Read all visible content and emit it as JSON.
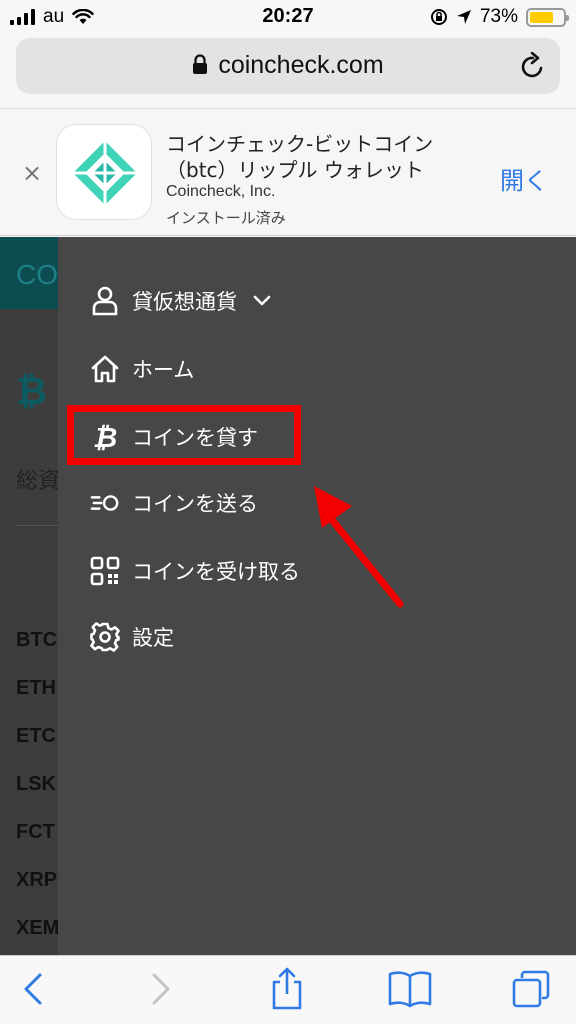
{
  "status_bar": {
    "carrier": "au",
    "time": "20:27",
    "battery": "73%",
    "battery_level": 0.73
  },
  "url_bar": {
    "domain": "coincheck.com"
  },
  "app_banner": {
    "title": "コインチェック-ビットコイン（btc）リップル ウォレット",
    "developer": "Coincheck, Inc.",
    "status": "インストール済み",
    "open_label": "開く",
    "close_label": "×"
  },
  "page": {
    "logo_text": "CO",
    "btc_symbol": "₿",
    "total_label": "総資",
    "coins": [
      "BTC",
      "ETH",
      "ETC",
      "LSK",
      "FCT",
      "XRP",
      "XEM"
    ]
  },
  "menu": {
    "items": [
      {
        "label": "貸仮想通貨",
        "icon": "user-icon"
      },
      {
        "label": "ホーム",
        "icon": "home-icon"
      },
      {
        "label": "コインを貸す",
        "icon": "bitcoin-icon"
      },
      {
        "label": "コインを送る",
        "icon": "send-icon"
      },
      {
        "label": "コインを受け取る",
        "icon": "qr-code-icon"
      },
      {
        "label": "設定",
        "icon": "gear-icon"
      }
    ],
    "highlighted_item": "コインを貸す"
  },
  "colors": {
    "accent_blue": "#2f7ae5",
    "menu_bg": "#474747",
    "highlight_red": "#f40000",
    "teal": "#0c4d52"
  }
}
